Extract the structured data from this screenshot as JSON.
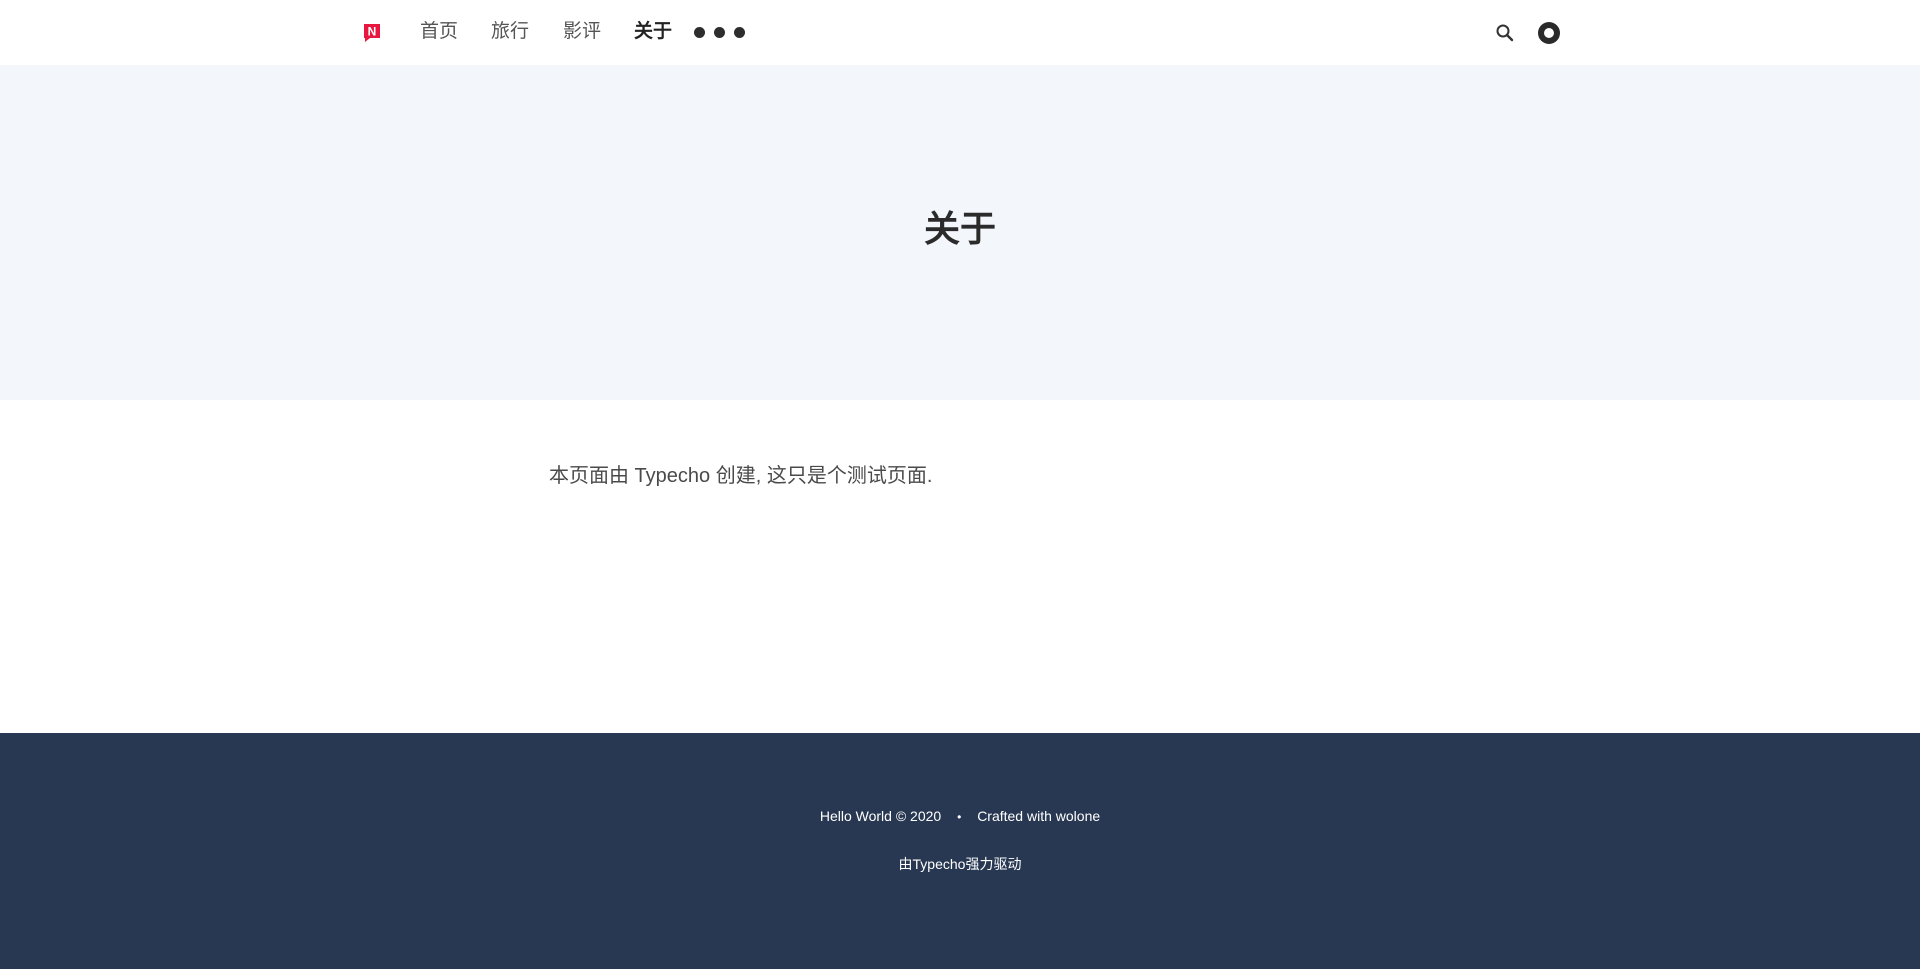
{
  "nav": {
    "logo_letter": "N",
    "logo_color": "#e8173f",
    "items": [
      {
        "label": "首页"
      },
      {
        "label": "旅行"
      },
      {
        "label": "影评"
      },
      {
        "label": "关于",
        "active": true
      }
    ],
    "more_icon": "more-dots-icon",
    "search_icon": "search-icon",
    "theme_icon": "theme-toggle-icon"
  },
  "hero": {
    "title": "关于",
    "background": "#f3f6fb"
  },
  "content": {
    "text": "本页面由 Typecho 创建, 这只是个测试页面."
  },
  "footer": {
    "copyright": "Hello World © 2020",
    "separator": "•",
    "crafted": "Crafted with wolone",
    "powered": "由Typecho强力驱动",
    "background": "#283852"
  }
}
